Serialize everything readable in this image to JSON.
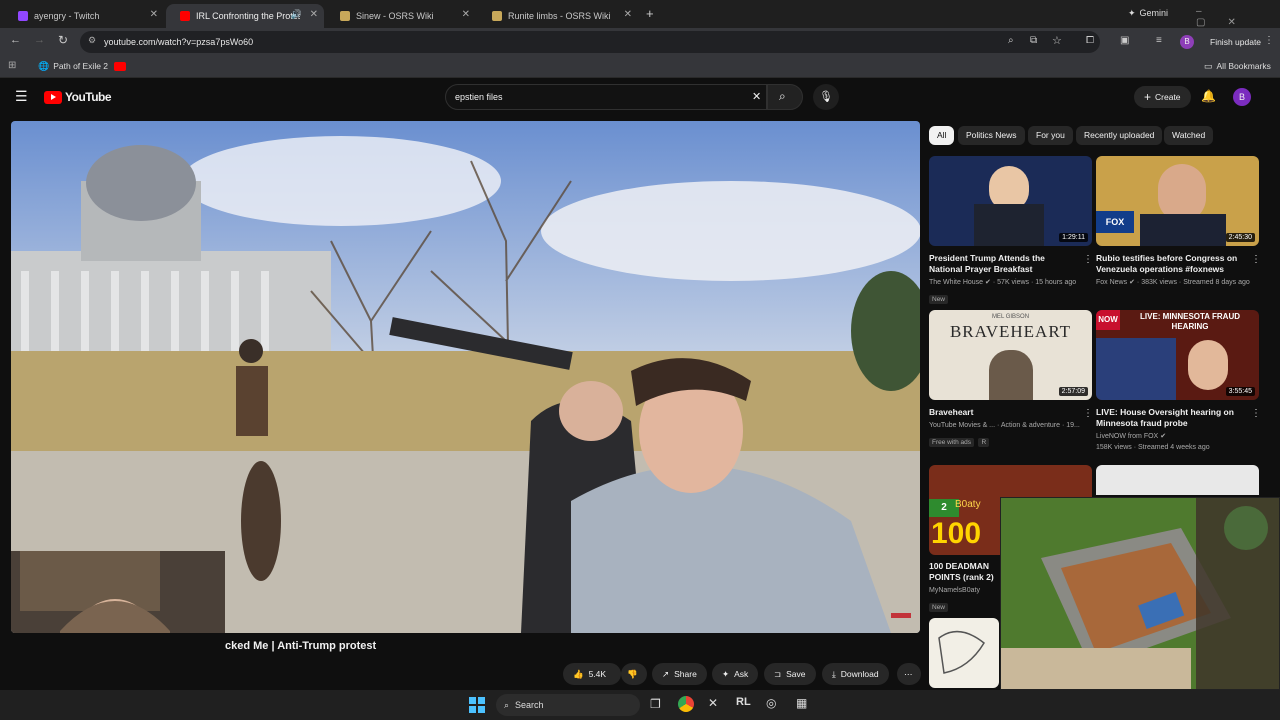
{
  "browser": {
    "tabs": [
      {
        "title": "ayengry - Twitch",
        "color": "#9147ff"
      },
      {
        "title": "IRL Confronting the Protest",
        "color": "#ff0000"
      },
      {
        "title": "Sinew - OSRS Wiki",
        "color": "#c8a85a"
      },
      {
        "title": "Runite limbs - OSRS Wiki",
        "color": "#c8a85a"
      }
    ],
    "gemini_label": "Gemini",
    "url": "youtube.com/watch?v=pzsa7psWo60",
    "profile_initial": "B",
    "finish_update_label": "Finish update",
    "bookmarks": [
      "Path of Exile 2"
    ],
    "all_bookmarks_label": "All Bookmarks"
  },
  "youtube": {
    "logo_text": "YouTube",
    "search_value": "epstien files",
    "create_label": "Create",
    "avatar_initial": "B",
    "chips": [
      "All",
      "Politics News",
      "For you",
      "Recently uploaded",
      "Watched"
    ],
    "video_title": "cked Me | Anti-Trump protest",
    "actions": {
      "like_count": "5.4K",
      "share": "Share",
      "ask": "Ask",
      "save": "Save",
      "download": "Download"
    },
    "recommendations": [
      {
        "title": "President Trump Attends the National Prayer Breakfast",
        "channel": "The White House",
        "meta": "57K views · 15 hours ago",
        "badge": "New",
        "duration": "1:29:11"
      },
      {
        "title": "Rubio testifies before Congress on Venezuela operations #foxnews #ne...",
        "channel": "Fox News",
        "meta": "383K views · Streamed 8 days ago",
        "badge": "",
        "duration": "2:45:30"
      },
      {
        "title": "Braveheart",
        "channel": "YouTube Movies & ...",
        "meta": "Action & adventure · 19...",
        "badge": "Free with ads",
        "badge2": "R",
        "duration": "2:57:09",
        "thumb_text": "BRAVEHEART",
        "thumb_sub": "MEL GIBSON"
      },
      {
        "title": "LIVE: House Oversight hearing on Minnesota fraud probe",
        "channel": "LiveNOW from FOX",
        "meta": "158K views · Streamed 4 weeks ago",
        "badge": "",
        "duration": "3:55:45",
        "thumb_text": "LIVE: MINNESOTA FRAUD HEARING",
        "thumb_now": "NOW"
      },
      {
        "title": "100 DEADMAN POINTS (rank 2)",
        "channel": "MyNamelsB0aty",
        "meta": "",
        "badge": "New",
        "thumb_text": "100",
        "thumb_sub": "B0aty"
      }
    ]
  },
  "taskbar": {
    "search_label": "Search"
  }
}
